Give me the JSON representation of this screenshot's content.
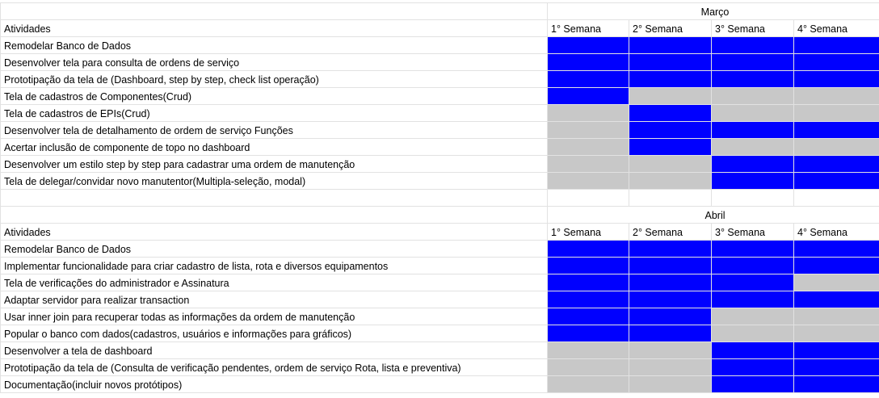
{
  "sections": [
    {
      "month": "Março",
      "header": [
        "Atividades",
        "1° Semana",
        "2° Semana",
        "3° Semana",
        "4° Semana"
      ],
      "tasks": [
        {
          "name": "Remodelar Banco de Dados",
          "weeks": [
            "blue",
            "blue",
            "blue",
            "blue"
          ]
        },
        {
          "name": "Desenvolver tela para consulta de ordens de serviço",
          "weeks": [
            "blue",
            "blue",
            "blue",
            "blue"
          ]
        },
        {
          "name": "Prototipação da tela de (Dashboard, step by step, check list operação)",
          "weeks": [
            "blue",
            "blue",
            "blue",
            "blue"
          ]
        },
        {
          "name": "Tela de cadastros de Componentes(Crud)",
          "weeks": [
            "blue",
            "gray",
            "gray",
            "gray"
          ]
        },
        {
          "name": "Tela de cadastros de EPIs(Crud)",
          "weeks": [
            "gray",
            "blue",
            "gray",
            "gray"
          ]
        },
        {
          "name": "Desenvolver tela de detalhamento de ordem de serviço Funções",
          "weeks": [
            "gray",
            "blue",
            "blue",
            "blue"
          ]
        },
        {
          "name": "Acertar inclusão de componente de topo no dashboard",
          "weeks": [
            "gray",
            "blue",
            "gray",
            "gray"
          ]
        },
        {
          "name": "Desenvolver um estilo step by step para cadastrar uma ordem de manutenção",
          "weeks": [
            "gray",
            "gray",
            "blue",
            "blue"
          ]
        },
        {
          "name": "Tela de delegar/convidar novo manutentor(Multipla-seleção, modal)",
          "weeks": [
            "gray",
            "gray",
            "blue",
            "blue"
          ]
        }
      ]
    },
    {
      "month": "Abril",
      "header": [
        "Atividades",
        "1° Semana",
        "2° Semana",
        "3° Semana",
        "4° Semana"
      ],
      "tasks": [
        {
          "name": "Remodelar Banco de Dados",
          "weeks": [
            "blue",
            "blue",
            "blue",
            "blue"
          ]
        },
        {
          "name": "Implementar funcionalidade para criar cadastro de lista, rota e diversos equipamentos",
          "weeks": [
            "blue",
            "blue",
            "blue",
            "blue"
          ]
        },
        {
          "name": "Tela de verificações do administrador e Assinatura",
          "weeks": [
            "blue",
            "blue",
            "blue",
            "gray"
          ]
        },
        {
          "name": "Adaptar servidor para realizar transaction",
          "weeks": [
            "blue",
            "blue",
            "blue",
            "blue"
          ]
        },
        {
          "name": "Usar inner join para recuperar todas as informações da ordem de manutenção",
          "weeks": [
            "blue",
            "blue",
            "gray",
            "gray"
          ]
        },
        {
          "name": "Popular o banco com dados(cadastros, usuários e informações para gráficos)",
          "weeks": [
            "blue",
            "blue",
            "gray",
            "gray"
          ]
        },
        {
          "name": "Desenvolver a tela de dashboard",
          "weeks": [
            "gray",
            "gray",
            "blue",
            "blue"
          ]
        },
        {
          "name": "Prototipação da tela de (Consulta de verificação pendentes, ordem de serviço Rota, lista e preventiva)",
          "weeks": [
            "gray",
            "gray",
            "blue",
            "blue"
          ]
        },
        {
          "name": "Documentação(incluir novos protótipos)",
          "weeks": [
            "gray",
            "gray",
            "blue",
            "blue"
          ]
        }
      ]
    }
  ],
  "colors": {
    "blue": "#0000ff",
    "gray": "#c8c8c8",
    "grid": "#e2e2e2"
  }
}
